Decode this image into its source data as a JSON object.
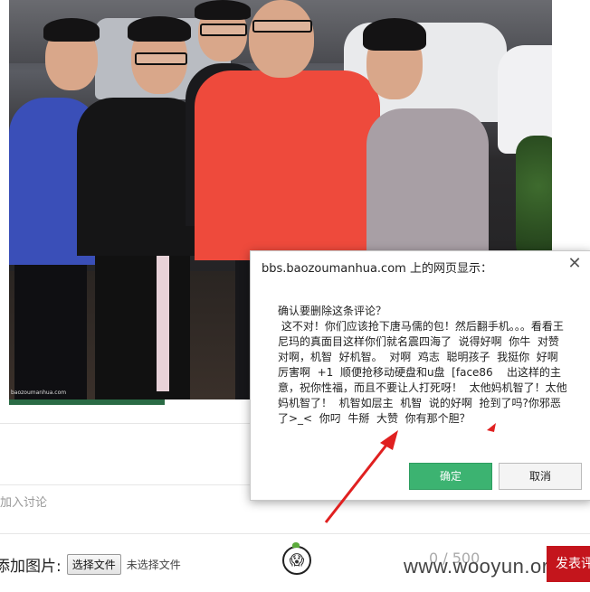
{
  "photo": {
    "caption": "baozoumanhua.com"
  },
  "page": {
    "join_discussion": "加入讨论",
    "upload_label": "添加图片:",
    "choose_file_button": "选择文件",
    "no_file_selected": "未选择文件",
    "char_counter": "0 / 500",
    "submit_label": "发表评论",
    "watermark": "www.wooyun.org"
  },
  "dialog": {
    "title": "bbs.baozoumanhua.com 上的网页显示：",
    "close_icon": "close-icon",
    "message": "确认要删除这条评论？\n 这不对！你们应该抢下唐马儒的包！然后翻手机。。。看看王尼玛的真面目这样你们就名震四海了  说得好啊  你牛  对赞  对啊，机智  好机智。  对啊  鸡志  聪明孩子  我挺你  好啊  厉害啊  +1  顺便抢移动硬盘和u盘  [face86    出这样的主意，祝你性福，而且不要让人打死呀！  太他妈机智了！太他妈机智了！  机智如层主  机智  说的好啊  抢到了吗?你邪恶了>_<  你叼  牛掰  大赞  你有那个胆？",
    "ok_label": "确定",
    "cancel_label": "取消"
  },
  "colors": {
    "ok_button": "#3cb371",
    "submit_button": "#c4151c",
    "arrow": "#e02020"
  }
}
